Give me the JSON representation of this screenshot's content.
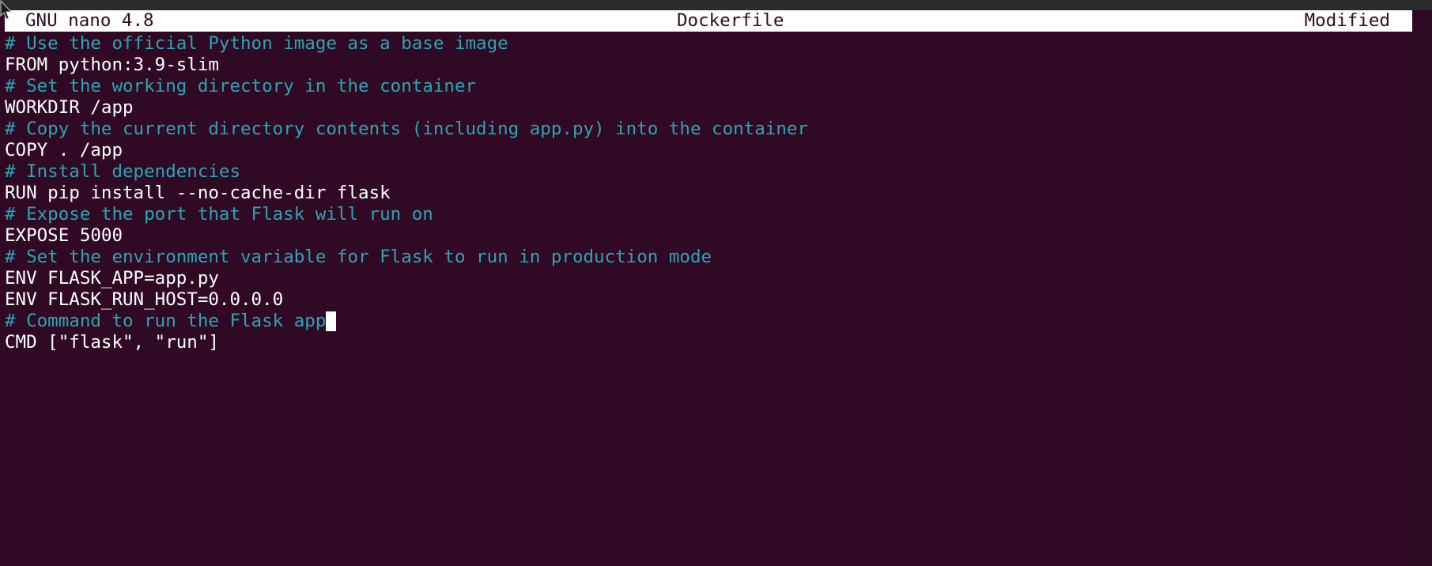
{
  "titlebar": {
    "app": "GNU nano 4.8",
    "filename": "Dockerfile",
    "status": "Modified"
  },
  "editor": {
    "lines": [
      {
        "kind": "comment",
        "text": "# Use the official Python image as a base image"
      },
      {
        "kind": "code",
        "text": "FROM python:3.9-slim"
      },
      {
        "kind": "comment",
        "text": "# Set the working directory in the container"
      },
      {
        "kind": "code",
        "text": "WORKDIR /app"
      },
      {
        "kind": "comment",
        "text": "# Copy the current directory contents (including app.py) into the container"
      },
      {
        "kind": "code",
        "text": "COPY . /app"
      },
      {
        "kind": "comment",
        "text": "# Install dependencies"
      },
      {
        "kind": "code",
        "text": "RUN pip install --no-cache-dir flask"
      },
      {
        "kind": "comment",
        "text": "# Expose the port that Flask will run on"
      },
      {
        "kind": "code",
        "text": "EXPOSE 5000"
      },
      {
        "kind": "comment",
        "text": "# Set the environment variable for Flask to run in production mode"
      },
      {
        "kind": "code",
        "text": "ENV FLASK_APP=app.py"
      },
      {
        "kind": "code",
        "text": "ENV FLASK_RUN_HOST=0.0.0.0"
      },
      {
        "kind": "comment",
        "text": "# Command to run the Flask app"
      },
      {
        "kind": "code",
        "text": "CMD [\"flask\", \"run\"]"
      }
    ],
    "cursor_line": 14
  },
  "colors": {
    "background": "#300a24",
    "comment": "#2aa5b3",
    "code": "#ffffff",
    "titlebar_bg": "#ffffff"
  },
  "icons": {
    "pointer": "mouse-pointer-icon"
  }
}
